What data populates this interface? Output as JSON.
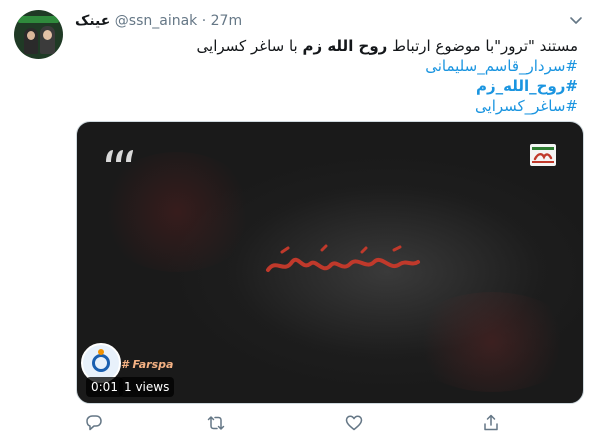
{
  "tweet": {
    "display_name": "عینک",
    "handle": "@ssn_ainak",
    "separator": "·",
    "time": "27m",
    "text": {
      "line1_before": "مستند \"ترور\"با موضوع ارتباط ",
      "line1_bold": "روح الله زم",
      "line1_after": " با ساغر کسرایی",
      "hashtag1": "#سردار_قاسم_سلیمانی",
      "hashtag2": "#روح_الله_زم",
      "hashtag3": "#ساغر_کسرایی"
    },
    "media": {
      "duration": "0:01",
      "views": "1 views",
      "channel_label": "# Farspa",
      "title_art": "مستند ترور",
      "brand_color": "#c0392b"
    },
    "icons": {
      "more": "chevron-down-icon",
      "reply": "reply-icon",
      "retweet": "retweet-icon",
      "like": "heart-icon",
      "share": "share-icon"
    },
    "colors": {
      "link": "#1b95e0",
      "muted": "#657786",
      "text": "#14171a"
    }
  }
}
